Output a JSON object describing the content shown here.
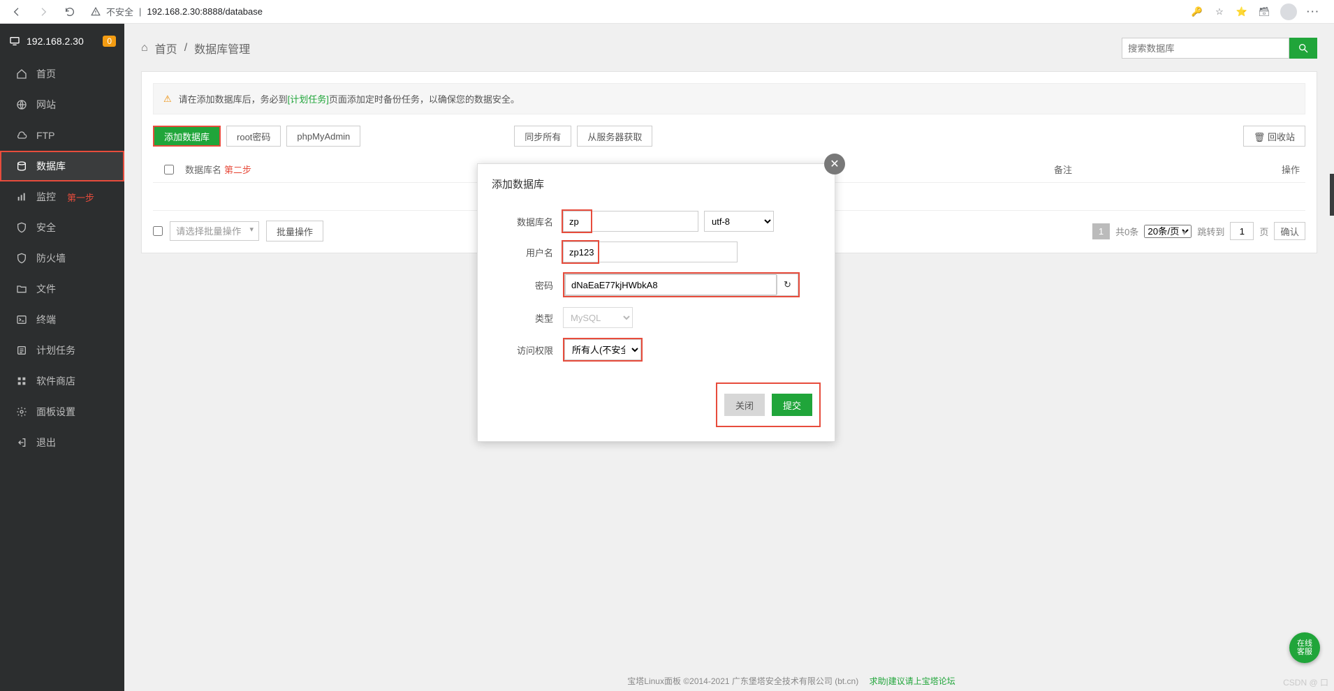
{
  "browser": {
    "insecure": "不安全",
    "url": "192.168.2.30:8888/database"
  },
  "sidebar": {
    "host": "192.168.2.30",
    "badge": "0",
    "items": [
      {
        "label": "首页"
      },
      {
        "label": "网站"
      },
      {
        "label": "FTP"
      },
      {
        "label": "数据库"
      },
      {
        "label": "监控",
        "step": "第一步"
      },
      {
        "label": "安全"
      },
      {
        "label": "防火墙"
      },
      {
        "label": "文件"
      },
      {
        "label": "终端"
      },
      {
        "label": "计划任务"
      },
      {
        "label": "软件商店"
      },
      {
        "label": "面板设置"
      },
      {
        "label": "退出"
      }
    ]
  },
  "crumb": {
    "home": "首页",
    "sep": "/",
    "current": "数据库管理"
  },
  "search": {
    "placeholder": "搜索数据库"
  },
  "alert": {
    "pre": "请在添加数据库后，务必到",
    "link": "[计划任务]",
    "post": "页面添加定时备份任务，以确保您的数据安全。"
  },
  "toolbar": {
    "add": "添加数据库",
    "rootpw": "root密码",
    "pma": "phpMyAdmin",
    "syncall": "同步所有",
    "fetch": "从服务器获取",
    "trash": "回收站"
  },
  "table": {
    "col_name": "数据库名",
    "step2": "第二步",
    "col_note": "备注",
    "col_ops": "操作"
  },
  "batch": {
    "placeholder": "请选择批量操作",
    "btn": "批量操作"
  },
  "pager": {
    "current": "1",
    "total": "共0条",
    "size": "20条/页",
    "jump": "跳转到",
    "jump_val": "1",
    "page_lbl": "页",
    "go": "确认"
  },
  "modal": {
    "title": "添加数据库",
    "labels": {
      "dbname": "数据库名",
      "user": "用户名",
      "pw": "密码",
      "type": "类型",
      "access": "访问权限"
    },
    "values": {
      "dbname": "zp",
      "encoding": "utf-8",
      "user": "zp123",
      "pw": "dNaEaE77kjHWbkA8",
      "type": "MySQL",
      "access": "所有人(不安全)"
    },
    "close": "关闭",
    "submit": "提交"
  },
  "footer": {
    "text": "宝塔Linux面板 ©2014-2021 广东堡塔安全技术有限公司 (bt.cn)　",
    "help": "求助|建议请上宝塔论坛"
  },
  "fab": "在线\n客服",
  "watermark": "CSDN @ 口"
}
